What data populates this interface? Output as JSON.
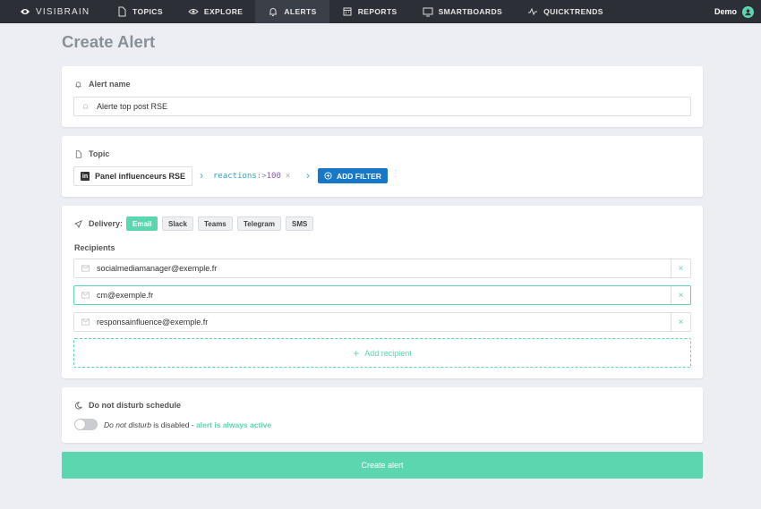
{
  "nav": {
    "brand": "VISIBRAIN",
    "items": [
      {
        "label": "TOPICS",
        "icon": "document-icon"
      },
      {
        "label": "EXPLORE",
        "icon": "eye-icon"
      },
      {
        "label": "ALERTS",
        "icon": "bell-icon",
        "active": true
      },
      {
        "label": "REPORTS",
        "icon": "calendar-icon"
      },
      {
        "label": "SMARTBOARDS",
        "icon": "monitor-icon"
      },
      {
        "label": "QUICKTRENDS",
        "icon": "pulse-icon"
      }
    ],
    "user": "Demo"
  },
  "page_title": "Create Alert",
  "alert_name": {
    "label": "Alert name",
    "value": "Alerte top post RSE"
  },
  "topic": {
    "label": "Topic",
    "panel": "Panel influenceurs RSE",
    "filter_key": "reactions",
    "filter_op": ":>",
    "filter_value": "100",
    "filter_remove": "×",
    "add_filter": "ADD FILTER"
  },
  "delivery": {
    "label": "Delivery:",
    "channels": [
      "Email",
      "Slack",
      "Teams",
      "Telegram",
      "SMS"
    ],
    "selected": "Email",
    "recipients_label": "Recipients",
    "recipients": [
      "socialmediamanager@exemple.fr",
      "cm@exemple.fr",
      "responsainfluence@exemple.fr"
    ],
    "remove_symbol": "×",
    "add_recipient": "Add recipient"
  },
  "dnd": {
    "label": "Do not disturb schedule",
    "text_italic": "Do not disturb",
    "text_mid": " is disabled - ",
    "text_active": "alert is always active"
  },
  "submit_label": "Create alert",
  "colors": {
    "accent": "#5bd6ae",
    "primary_button": "#1877c9",
    "navbar": "#2c2f36"
  }
}
